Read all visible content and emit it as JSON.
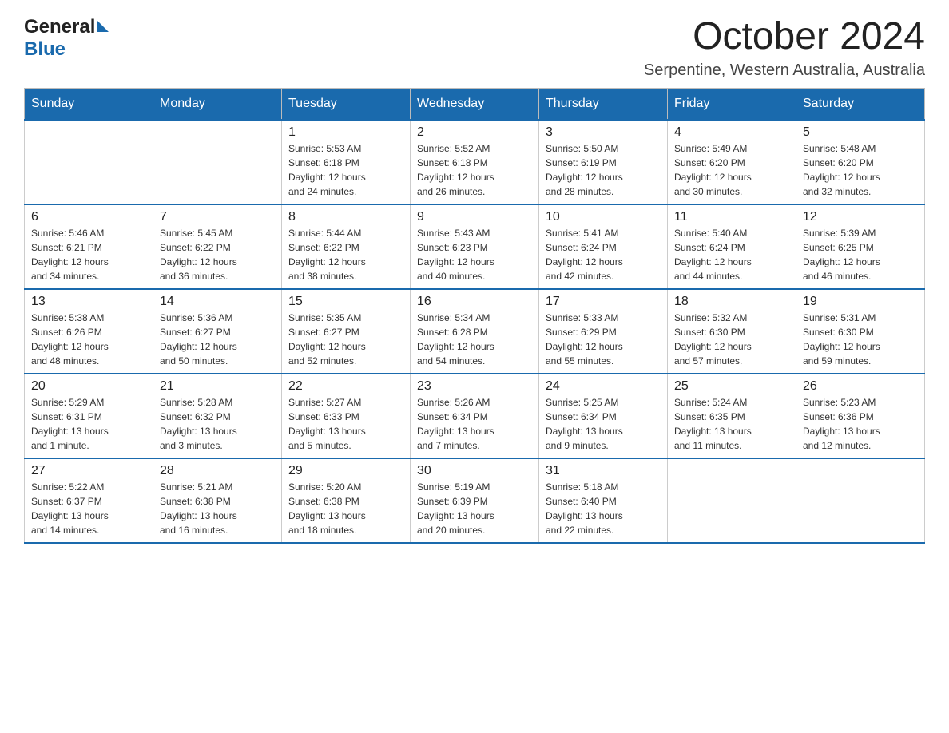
{
  "header": {
    "logo_general": "General",
    "logo_blue": "Blue",
    "month_title": "October 2024",
    "location": "Serpentine, Western Australia, Australia"
  },
  "calendar": {
    "days_of_week": [
      "Sunday",
      "Monday",
      "Tuesday",
      "Wednesday",
      "Thursday",
      "Friday",
      "Saturday"
    ],
    "weeks": [
      [
        {
          "day": "",
          "info": ""
        },
        {
          "day": "",
          "info": ""
        },
        {
          "day": "1",
          "info": "Sunrise: 5:53 AM\nSunset: 6:18 PM\nDaylight: 12 hours\nand 24 minutes."
        },
        {
          "day": "2",
          "info": "Sunrise: 5:52 AM\nSunset: 6:18 PM\nDaylight: 12 hours\nand 26 minutes."
        },
        {
          "day": "3",
          "info": "Sunrise: 5:50 AM\nSunset: 6:19 PM\nDaylight: 12 hours\nand 28 minutes."
        },
        {
          "day": "4",
          "info": "Sunrise: 5:49 AM\nSunset: 6:20 PM\nDaylight: 12 hours\nand 30 minutes."
        },
        {
          "day": "5",
          "info": "Sunrise: 5:48 AM\nSunset: 6:20 PM\nDaylight: 12 hours\nand 32 minutes."
        }
      ],
      [
        {
          "day": "6",
          "info": "Sunrise: 5:46 AM\nSunset: 6:21 PM\nDaylight: 12 hours\nand 34 minutes."
        },
        {
          "day": "7",
          "info": "Sunrise: 5:45 AM\nSunset: 6:22 PM\nDaylight: 12 hours\nand 36 minutes."
        },
        {
          "day": "8",
          "info": "Sunrise: 5:44 AM\nSunset: 6:22 PM\nDaylight: 12 hours\nand 38 minutes."
        },
        {
          "day": "9",
          "info": "Sunrise: 5:43 AM\nSunset: 6:23 PM\nDaylight: 12 hours\nand 40 minutes."
        },
        {
          "day": "10",
          "info": "Sunrise: 5:41 AM\nSunset: 6:24 PM\nDaylight: 12 hours\nand 42 minutes."
        },
        {
          "day": "11",
          "info": "Sunrise: 5:40 AM\nSunset: 6:24 PM\nDaylight: 12 hours\nand 44 minutes."
        },
        {
          "day": "12",
          "info": "Sunrise: 5:39 AM\nSunset: 6:25 PM\nDaylight: 12 hours\nand 46 minutes."
        }
      ],
      [
        {
          "day": "13",
          "info": "Sunrise: 5:38 AM\nSunset: 6:26 PM\nDaylight: 12 hours\nand 48 minutes."
        },
        {
          "day": "14",
          "info": "Sunrise: 5:36 AM\nSunset: 6:27 PM\nDaylight: 12 hours\nand 50 minutes."
        },
        {
          "day": "15",
          "info": "Sunrise: 5:35 AM\nSunset: 6:27 PM\nDaylight: 12 hours\nand 52 minutes."
        },
        {
          "day": "16",
          "info": "Sunrise: 5:34 AM\nSunset: 6:28 PM\nDaylight: 12 hours\nand 54 minutes."
        },
        {
          "day": "17",
          "info": "Sunrise: 5:33 AM\nSunset: 6:29 PM\nDaylight: 12 hours\nand 55 minutes."
        },
        {
          "day": "18",
          "info": "Sunrise: 5:32 AM\nSunset: 6:30 PM\nDaylight: 12 hours\nand 57 minutes."
        },
        {
          "day": "19",
          "info": "Sunrise: 5:31 AM\nSunset: 6:30 PM\nDaylight: 12 hours\nand 59 minutes."
        }
      ],
      [
        {
          "day": "20",
          "info": "Sunrise: 5:29 AM\nSunset: 6:31 PM\nDaylight: 13 hours\nand 1 minute."
        },
        {
          "day": "21",
          "info": "Sunrise: 5:28 AM\nSunset: 6:32 PM\nDaylight: 13 hours\nand 3 minutes."
        },
        {
          "day": "22",
          "info": "Sunrise: 5:27 AM\nSunset: 6:33 PM\nDaylight: 13 hours\nand 5 minutes."
        },
        {
          "day": "23",
          "info": "Sunrise: 5:26 AM\nSunset: 6:34 PM\nDaylight: 13 hours\nand 7 minutes."
        },
        {
          "day": "24",
          "info": "Sunrise: 5:25 AM\nSunset: 6:34 PM\nDaylight: 13 hours\nand 9 minutes."
        },
        {
          "day": "25",
          "info": "Sunrise: 5:24 AM\nSunset: 6:35 PM\nDaylight: 13 hours\nand 11 minutes."
        },
        {
          "day": "26",
          "info": "Sunrise: 5:23 AM\nSunset: 6:36 PM\nDaylight: 13 hours\nand 12 minutes."
        }
      ],
      [
        {
          "day": "27",
          "info": "Sunrise: 5:22 AM\nSunset: 6:37 PM\nDaylight: 13 hours\nand 14 minutes."
        },
        {
          "day": "28",
          "info": "Sunrise: 5:21 AM\nSunset: 6:38 PM\nDaylight: 13 hours\nand 16 minutes."
        },
        {
          "day": "29",
          "info": "Sunrise: 5:20 AM\nSunset: 6:38 PM\nDaylight: 13 hours\nand 18 minutes."
        },
        {
          "day": "30",
          "info": "Sunrise: 5:19 AM\nSunset: 6:39 PM\nDaylight: 13 hours\nand 20 minutes."
        },
        {
          "day": "31",
          "info": "Sunrise: 5:18 AM\nSunset: 6:40 PM\nDaylight: 13 hours\nand 22 minutes."
        },
        {
          "day": "",
          "info": ""
        },
        {
          "day": "",
          "info": ""
        }
      ]
    ]
  }
}
